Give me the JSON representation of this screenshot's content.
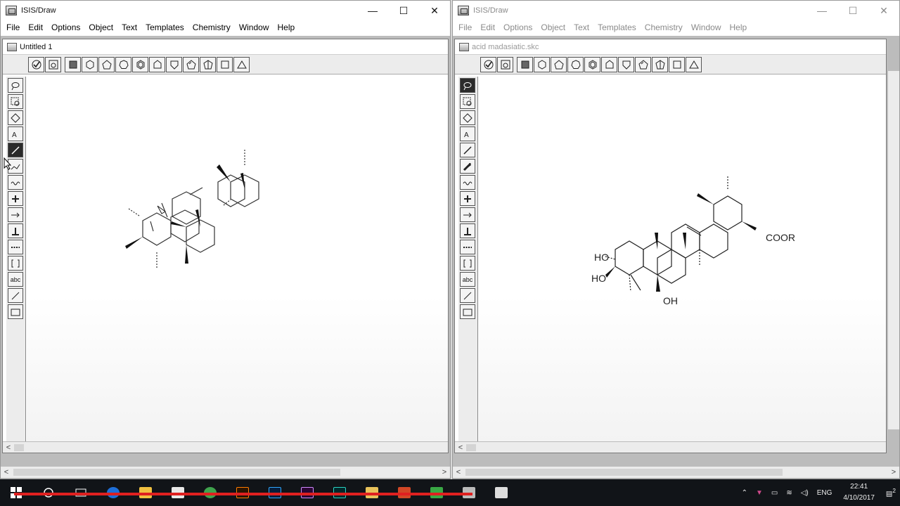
{
  "left_window": {
    "title": "ISIS/Draw",
    "doc_title": "Untitled 1"
  },
  "right_window": {
    "title": "ISIS/Draw",
    "doc_title": "acid madasiatic.skc",
    "labels": {
      "ho_top": "HO",
      "ho_bottom": "HO",
      "oh": "OH",
      "coor": "COOR"
    }
  },
  "menu": [
    "File",
    "Edit",
    "Options",
    "Object",
    "Text",
    "Templates",
    "Chemistry",
    "Window",
    "Help"
  ],
  "window_buttons": {
    "minimize": "—",
    "maximize": "☐",
    "close": "✕"
  },
  "left_tools": [
    "lasso",
    "select",
    "eraser",
    "atom",
    "bond",
    "chain",
    "wave",
    "plus",
    "arrow",
    "chain-h",
    "dots",
    "bracket",
    "abc",
    "line",
    "rect"
  ],
  "tool_abc_label": "abc",
  "scroll": {
    "left_arrow": "<",
    "right_arrow": ">"
  },
  "taskbar": {
    "language": "ENG",
    "time": "22:41",
    "date": "4/10/2017",
    "notif_count": "2"
  },
  "colors": {
    "taskbar": "#111418",
    "accent_red": "#e02020"
  }
}
